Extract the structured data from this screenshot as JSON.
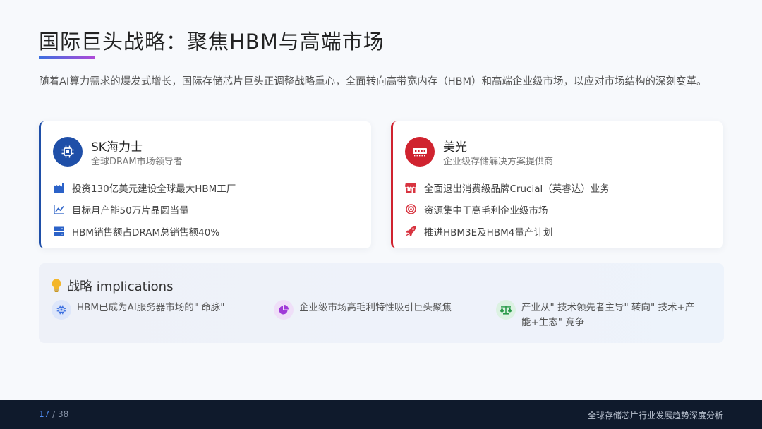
{
  "title": "国际巨头战略：聚焦HBM与高端市场",
  "intro": "随着AI算力需求的爆发式增长，国际存储芯片巨头正调整战略重心，全面转向高带宽内存（HBM）和高端企业级市场，以应对市场结构的深刻变革。",
  "cards": [
    {
      "name": "SK海力士",
      "subtitle": "全球DRAM市场领导者",
      "logo_icon": "chip-icon",
      "accent": "#1f4fa8",
      "items": [
        {
          "icon": "factory-icon",
          "text": "投资130亿美元建设全球最大HBM工厂"
        },
        {
          "icon": "line-chart-icon",
          "text": "目标月产能50万片晶圆当量"
        },
        {
          "icon": "server-icon",
          "text": "HBM销售额占DRAM总销售额40%"
        }
      ]
    },
    {
      "name": "美光",
      "subtitle": "企业级存储解决方案提供商",
      "logo_icon": "memory-icon",
      "accent": "#d0232f",
      "items": [
        {
          "icon": "store-icon",
          "text": "全面退出消费级品牌Crucial（英睿达）业务"
        },
        {
          "icon": "target-icon",
          "text": "资源集中于高毛利企业级市场"
        },
        {
          "icon": "rocket-icon",
          "text": "推进HBM3E及HBM4量产计划"
        }
      ]
    }
  ],
  "implications": {
    "title": "战略 implications",
    "items": [
      {
        "icon": "chip-icon",
        "color": "#3b6fe0",
        "text": "HBM已成为AI服务器市场的\" 命脉\""
      },
      {
        "icon": "pie-chart-icon",
        "color": "#a03ad8",
        "text": "企业级市场高毛利特性吸引巨头聚焦"
      },
      {
        "icon": "balance-scale-icon",
        "color": "#2a9a4a",
        "text": "产业从\" 技术领先者主导\" 转向\" 技术+产能+生态\" 竞争"
      }
    ]
  },
  "footer": {
    "current_page": "17",
    "page_sep": " / 38",
    "title": "全球存储芯片行业发展趋势深度分析"
  }
}
